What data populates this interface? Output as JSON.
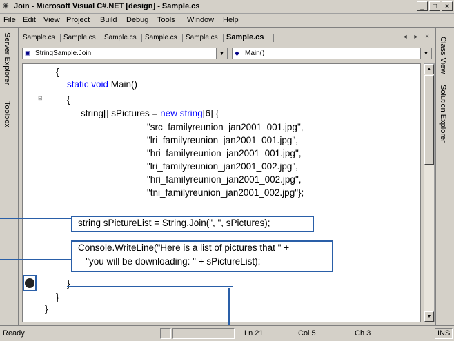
{
  "window": {
    "title": "Join - Microsoft Visual C#.NET [design] - Sample.cs",
    "buttons": [
      "_",
      "□",
      "×"
    ]
  },
  "menu": [
    "File",
    "Edit",
    "View",
    "Project",
    "Build",
    "Debug",
    "Tools",
    "Window",
    "Help"
  ],
  "left_panels": [
    "Server Explorer",
    "Toolbox"
  ],
  "right_panels": [
    "Class View",
    "Solution Explorer"
  ],
  "tabs": [
    "Sample.cs",
    "Sample.cs",
    "Sample.cs",
    "Sample.cs",
    "Sample.cs",
    "Sample.cs"
  ],
  "active_tab": "Sample.cs",
  "tab_controls": "◂ ▸ ×",
  "type_dropdown": "StringSample.Join",
  "member_dropdown": "Main()",
  "code": {
    "l0": "{",
    "l1_kw": "static void",
    "l1": " Main()",
    "l2": "{",
    "l3a": "string[] sPictures = ",
    "l3_kw": "new string",
    "l3b": "[6] {",
    "l4": "\"src_familyreunion_jan2001_001.jpg\",",
    "l5": "\"lri_familyreunion_jan2001_001.jpg\",",
    "l6": "\"hri_familyreunion_jan2001_001.jpg\",",
    "l7": "\"lri_familyreunion_jan2001_002.jpg\",",
    "l8": "\"hri_familyreunion_jan2001_002.jpg\",",
    "l9": "\"tni_familyreunion_jan2001_002.jpg\"};",
    "l10": "string sPictureList = String.Join(\", \", sPictures);",
    "l11": "Console.WriteLine(\"Here is a list of pictures that \" +",
    "l12": "   \"you will be downloading: \" + sPictureList);",
    "l13": "}",
    "l14": "}",
    "l15": "}"
  },
  "status": {
    "ready": "Ready",
    "line": "Ln 21",
    "col": "Col 5",
    "ch": "Ch 3",
    "mode": "INS"
  },
  "colors": {
    "callout": "#2a5fa8",
    "keyword": "#0000ff"
  }
}
